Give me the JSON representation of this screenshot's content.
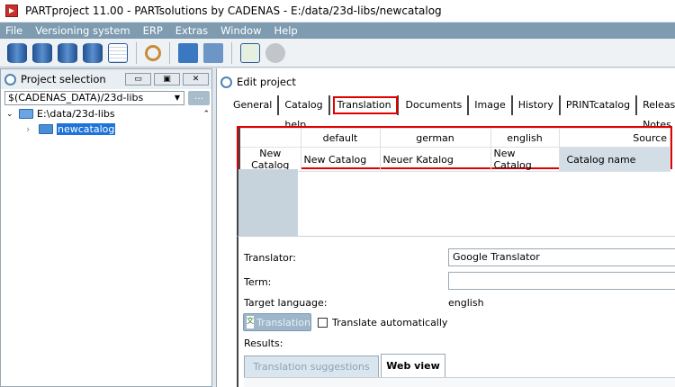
{
  "window": {
    "title": "PARTproject 11.00 - PARTsolutions by CADENAS - E:/data/23d-libs/newcatalog"
  },
  "menu": [
    "File",
    "Versioning system",
    "ERP",
    "Extras",
    "Window",
    "Help"
  ],
  "left_panel": {
    "title": "Project selection",
    "path_value": "$(CADENAS_DATA)/23d-libs",
    "browse_label": "...",
    "tree": [
      {
        "label": "E:\\data/23d-libs"
      },
      {
        "label": "newcatalog"
      }
    ]
  },
  "right_panel": {
    "title": "Edit project",
    "tabs": [
      "General",
      "Catalog help",
      "Translation",
      "Documents",
      "Image",
      "History",
      "PRINTcatalog",
      "Release Notes"
    ],
    "table": {
      "columns": [
        "default",
        "german",
        "english",
        "Source"
      ],
      "row_header": "New Catalog",
      "row": [
        "New Catalog",
        "Neuer Katalog",
        "New Catalog",
        "Catalog name"
      ]
    },
    "form": {
      "translator_label": "Translator:",
      "translator_value": "Google Translator",
      "term_label": "Term:",
      "term_value": "",
      "target_label": "Target language:",
      "target_value": "english",
      "translate_button": "Translation",
      "auto_label": "Translate automatically",
      "results_label": "Results:"
    },
    "result_tabs": [
      "Translation suggestions",
      "Web view"
    ]
  }
}
